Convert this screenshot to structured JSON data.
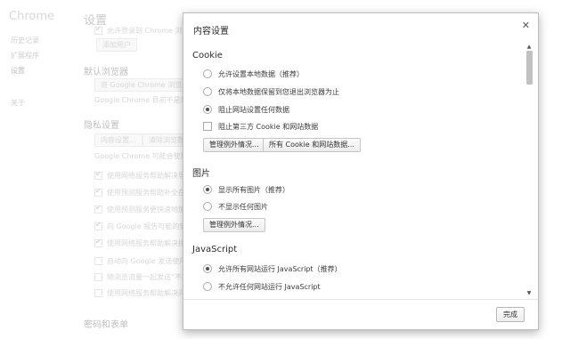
{
  "background": {
    "app_title": "Chrome",
    "nav_items": [
      "历史记录",
      "扩展程序",
      "设置",
      "关于"
    ],
    "page_title": "设置",
    "sync_text": "允许登录到 Chrome 浏览器",
    "sync_button": "添加用户",
    "section_default_browser": "默认浏览器",
    "default_browser_button": "将 Google Chrome 浏览器设置为默认浏览器",
    "default_browser_note": "Google Chrome 目前不是您的默认浏览器。",
    "section_privacy": "隐私设置",
    "privacy_button_1": "内容设置...",
    "privacy_button_2": "清除浏览数据...",
    "privacy_note": "Google Chrome 可能会使用网络服务改善您的浏览体验。",
    "privacy_options": [
      {
        "label": "使用网络服务帮助解决导航错误",
        "checked": true
      },
      {
        "label": "使用预测服务帮助补全在地址栏中输入的搜索查询",
        "checked": true
      },
      {
        "label": "使用预测服务更快速地加载网页",
        "checked": true
      },
      {
        "label": "向 Google 报告可能的安全问题",
        "checked": true
      },
      {
        "label": "使用网络服务帮助解决拼写错误",
        "checked": true
      },
      {
        "label": "自动向 Google 发送使用情况统计信息",
        "checked": false
      },
      {
        "label": "随浏览流量一起发送“不跟踪”请求",
        "checked": false
      },
      {
        "label": "使用网络服务帮助解决问题",
        "checked": false
      }
    ],
    "section_passwords": "密码和表单"
  },
  "dialog": {
    "title": "内容设置",
    "close_icon": "close-icon",
    "cookie": {
      "title": "Cookie",
      "options": [
        {
          "label": "允许设置本地数据（推荐）",
          "selected": false
        },
        {
          "label": "仅将本地数据保留到您退出浏览器为止",
          "selected": false
        },
        {
          "label": "阻止网站设置任何数据",
          "selected": true
        }
      ],
      "block_third_party_label": "阻止第三方 Cookie 和网站数据",
      "block_third_party_checked": false,
      "manage_exceptions": "管理例外情况...",
      "all_cookies": "所有 Cookie 和网站数据..."
    },
    "images": {
      "title": "图片",
      "options": [
        {
          "label": "显示所有图片（推荐）",
          "selected": true
        },
        {
          "label": "不显示任何图片",
          "selected": false
        }
      ],
      "manage_exceptions": "管理例外情况..."
    },
    "javascript": {
      "title": "JavaScript",
      "options": [
        {
          "label": "允许所有网站运行 JavaScript（推荐）",
          "selected": true
        },
        {
          "label": "不允许任何网站运行 JavaScript",
          "selected": false
        }
      ]
    },
    "done_button": "完成"
  },
  "colors": {
    "dialog_border": "#bdbdbd",
    "overlay": "rgba(255,255,255,0.45)"
  }
}
